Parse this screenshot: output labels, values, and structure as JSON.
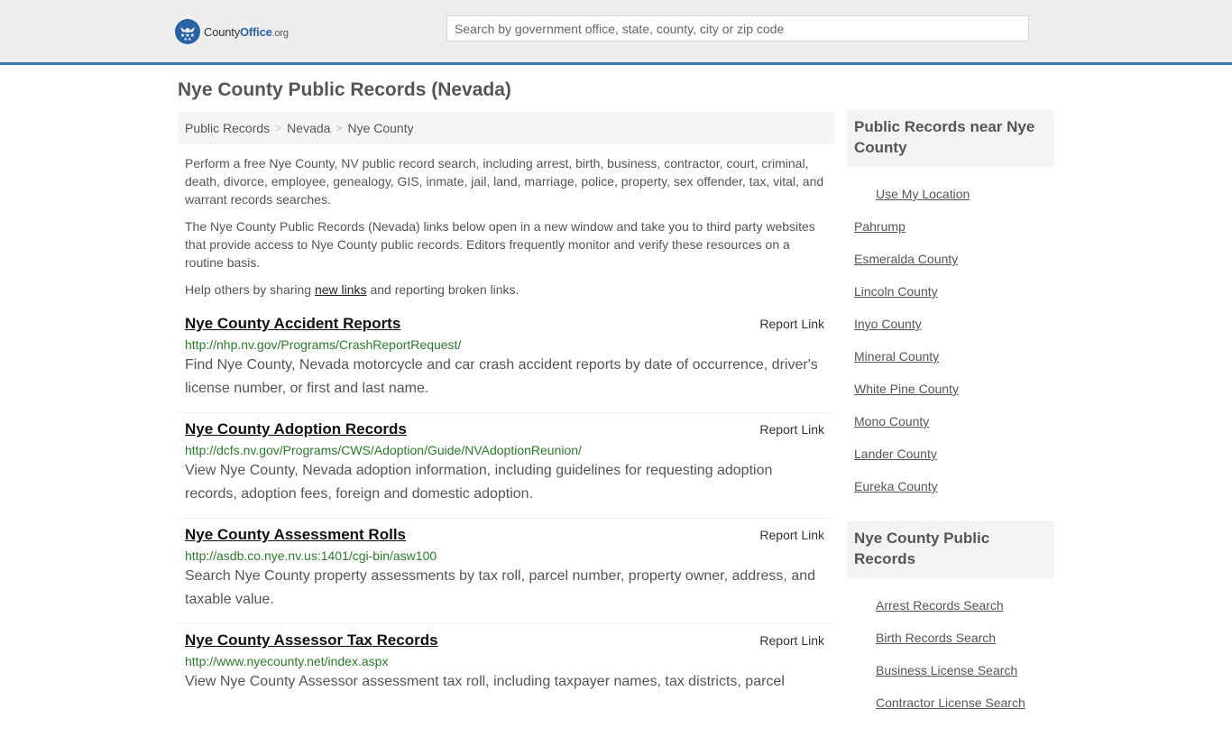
{
  "header": {
    "logo": {
      "name_part1": "County",
      "name_part2": "Office",
      "name_part3": ".org"
    },
    "search": {
      "placeholder": "Search by government office, state, county, city or zip code",
      "value": ""
    },
    "colors": {
      "brand": "#2a62a6",
      "header_border": "#3c78b0",
      "url_green": "#2b7a2b"
    }
  },
  "page": {
    "title": "Nye County Public Records (Nevada)"
  },
  "breadcrumb": [
    {
      "label": "Public Records"
    },
    {
      "label": "Nevada"
    },
    {
      "label": "Nye County"
    }
  ],
  "intro": {
    "p1": "Perform a free Nye County, NV public record search, including arrest, birth, business, contractor, court, criminal, death, divorce, employee, genealogy, GIS, inmate, jail, land, marriage, police, property, sex offender, tax, vital, and warrant records searches.",
    "p2": "The Nye County Public Records (Nevada) links below open in a new window and take you to third party websites that provide access to Nye County public records. Editors frequently monitor and verify these resources on a routine basis.",
    "p3_before": "Help others by sharing ",
    "p3_link": "new links",
    "p3_after": " and reporting broken links."
  },
  "records": [
    {
      "title": "Nye County Accident Reports",
      "report_label": "Report Link",
      "url": "http://nhp.nv.gov/Programs/CrashReportRequest/",
      "description": "Find Nye County, Nevada motorcycle and car crash accident reports by date of occurrence, driver's license number, or first and last name."
    },
    {
      "title": "Nye County Adoption Records",
      "report_label": "Report Link",
      "url": "http://dcfs.nv.gov/Programs/CWS/Adoption/Guide/NVAdoptionReunion/",
      "description": "View Nye County, Nevada adoption information, including guidelines for requesting adoption records, adoption fees, foreign and domestic adoption."
    },
    {
      "title": "Nye County Assessment Rolls",
      "report_label": "Report Link",
      "url": "http://asdb.co.nye.nv.us:1401/cgi-bin/asw100",
      "description": "Search Nye County property assessments by tax roll, parcel number, property owner, address, and taxable value."
    },
    {
      "title": "Nye County Assessor Tax Records",
      "report_label": "Report Link",
      "url": "http://www.nyecounty.net/index.aspx",
      "description": "View Nye County Assessor assessment tax roll, including taxpayer names, tax districts, parcel"
    }
  ],
  "sidebar": {
    "nearby": {
      "heading": "Public Records near Nye County",
      "use_location": "Use My Location",
      "items": [
        {
          "label": "Pahrump"
        },
        {
          "label": "Esmeralda County"
        },
        {
          "label": "Lincoln County"
        },
        {
          "label": "Inyo County"
        },
        {
          "label": "Mineral County"
        },
        {
          "label": "White Pine County"
        },
        {
          "label": "Mono County"
        },
        {
          "label": "Lander County"
        },
        {
          "label": "Eureka County"
        }
      ]
    },
    "county_records": {
      "heading": "Nye County Public Records",
      "items": [
        {
          "label": "Arrest Records Search"
        },
        {
          "label": "Birth Records Search"
        },
        {
          "label": "Business License Search"
        },
        {
          "label": "Contractor License Search"
        }
      ]
    }
  }
}
